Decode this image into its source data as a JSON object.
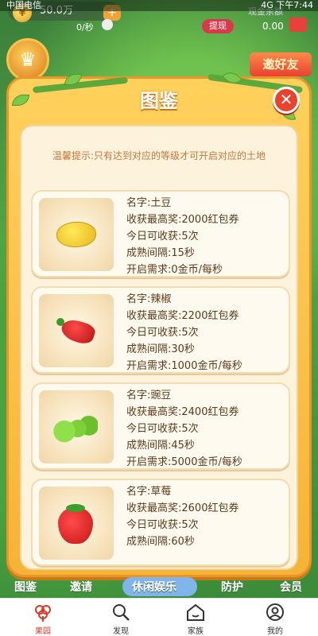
{
  "status_bar": {
    "left": "中国电信",
    "right": "4G  下午7:44"
  },
  "top_bar": {
    "coin_value": "50.0万",
    "coin_icon": "coin-icon",
    "rate": "0/秒",
    "withdraw_label": "提现",
    "cash_label": "现金余额",
    "cash_value": "0.00"
  },
  "side_badges": {
    "invite_label": "邀好友"
  },
  "modal": {
    "title": "图鉴",
    "close_icon": "close-icon",
    "tip": "温馨提示:只有达到对应的等级才可开启对应的土地",
    "crops": [
      {
        "icon": "potato-icon",
        "name": "名字:土豆",
        "max_reward": "收获最高奖:2000红包券",
        "harvests": "今日可收获:5次",
        "interval": "成熟间隔:15秒",
        "unlock": "开启需求:0金币/每秒"
      },
      {
        "icon": "chili-icon",
        "name": "名字:辣椒",
        "max_reward": "收获最高奖:2200红包券",
        "harvests": "今日可收获:5次",
        "interval": "成熟间隔:30秒",
        "unlock": "开启需求:1000金币/每秒"
      },
      {
        "icon": "pea-icon",
        "name": "名字:豌豆",
        "max_reward": "收获最高奖:2400红包券",
        "harvests": "今日可收获:5次",
        "interval": "成熟间隔:45秒",
        "unlock": "开启需求:5000金币/每秒"
      },
      {
        "icon": "strawberry-icon",
        "name": "名字:草莓",
        "max_reward": "收获最高奖:2600红包券",
        "harvests": "今日可收获:5次",
        "interval": "成熟间隔:60秒"
      }
    ]
  },
  "scene_menu": {
    "items": [
      "图鉴",
      "邀请",
      "休闲娱乐",
      "防护",
      "会员"
    ]
  },
  "bottom_nav": {
    "items": [
      {
        "label": "果园",
        "icon": "orchard-icon"
      },
      {
        "label": "发现",
        "icon": "search-icon"
      },
      {
        "label": "家族",
        "icon": "home-icon"
      },
      {
        "label": "我的",
        "icon": "profile-icon"
      }
    ],
    "active_index": 0
  },
  "colors": {
    "modal_frame": "#f6b336",
    "modal_inner": "#fdf3dd",
    "close_button": "#e8432f",
    "tip_text": "#c2783a",
    "active_nav": "#d83a2a"
  }
}
